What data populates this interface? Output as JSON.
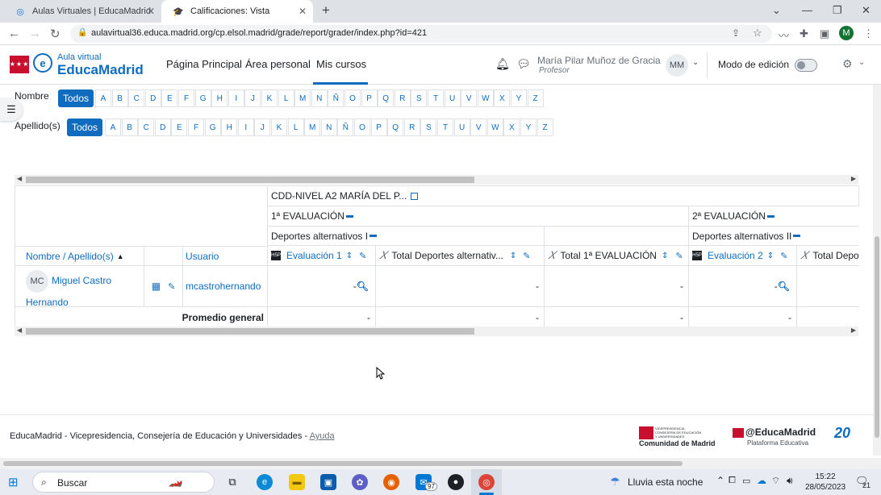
{
  "browser": {
    "tabs": [
      {
        "title": "Aulas Virtuales | EducaMadrid",
        "active": false
      },
      {
        "title": "Calificaciones: Vista",
        "active": true
      }
    ],
    "new_tab_glyph": "+",
    "url": "aulavirtual36.educa.madrid.org/cp.elsol.madrid/grade/report/grader/index.php?id=421",
    "profile_initial": "M"
  },
  "header": {
    "logo_small": "Aula virtual",
    "logo_big": "EducaMadrid",
    "nav": [
      "Página Principal",
      "Área personal",
      "Mis cursos"
    ],
    "user_name": "María Pilar Muñoz de Gracia",
    "user_role": "Profesor",
    "user_initials": "MM",
    "edit_mode_label": "Modo de edición"
  },
  "filters": {
    "first_name_label": "Nombre",
    "last_name_label": "Apellido(s)",
    "all_label": "Todos",
    "letters": [
      "A",
      "B",
      "C",
      "D",
      "E",
      "F",
      "G",
      "H",
      "I",
      "J",
      "K",
      "L",
      "M",
      "N",
      "Ñ",
      "O",
      "P",
      "Q",
      "R",
      "S",
      "T",
      "U",
      "V",
      "W",
      "X",
      "Y",
      "Z"
    ]
  },
  "grader": {
    "course_title": "CDD-NIVEL A2 MARÍA DEL P...",
    "cat1": "1ª EVALUACIÓN",
    "cat2": "2ª EVALUACIÓN",
    "subcat1": "Deportes alternativos I",
    "subcat2": "Deportes alternativos II",
    "col_name": "Nombre / Apellido(s)",
    "col_user": "Usuario",
    "items": [
      "Evaluación 1",
      "Total Deportes alternativ...",
      "Total 1ª EVALUACIÓN",
      "Evaluación 2",
      "Total Depo"
    ],
    "student": {
      "initials": "MC",
      "name_line1": "Miguel Castro",
      "name_line2": "Hernando",
      "username": "mcastrohernando",
      "grades": [
        "-",
        "-",
        "-",
        "-"
      ]
    },
    "average_label": "Promedio general",
    "averages": [
      "-",
      "-",
      "-",
      "-"
    ]
  },
  "footer": {
    "brand": "EducaMadrid",
    "text": " - Vicepresidencia, Consejería de Educación y Universidades - ",
    "help_link": "Ayuda",
    "cm_small": "VICEPRESIDENCIA, CONSEJERÍA DE EDUCACIÓN Y UNIVERSIDADES",
    "cm_name": "Comunidad de Madrid",
    "em_name": "EducaMadrid",
    "em_sub": "Plataforma Educativa",
    "anniv": "20"
  },
  "taskbar": {
    "search_placeholder": "Buscar",
    "weather": "Lluvia esta noche",
    "time": "15:22",
    "date": "28/05/2023",
    "mail_badge": "97",
    "notif_badge": "21"
  },
  "colors": {
    "accent": "#0f6cbf",
    "educa_red": "#c8102e"
  }
}
